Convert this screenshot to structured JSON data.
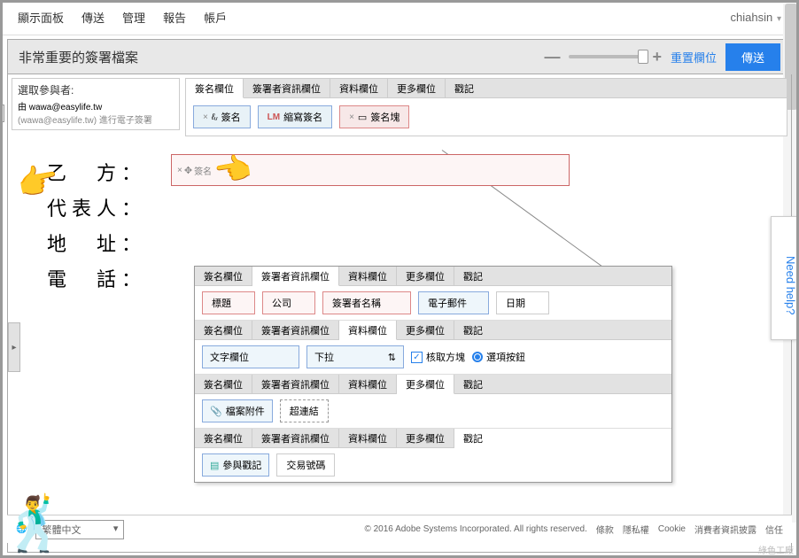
{
  "topnav": {
    "items": [
      "顯示面板",
      "傳送",
      "管理",
      "報告",
      "帳戶"
    ],
    "user": "chiahsin"
  },
  "doc": {
    "title": "非常重要的簽署檔案",
    "reset": "重置欄位",
    "send": "傳送"
  },
  "participant": {
    "label": "選取參與者:",
    "line1": "由 wawa@easylife.tw",
    "line2": "(wawa@easylife.tw) 進行電子簽署"
  },
  "tabs": [
    "簽名欄位",
    "簽署者資訊欄位",
    "資料欄位",
    "更多欄位",
    "戳記"
  ],
  "sig_fields": {
    "sign": "簽名",
    "sign_prefix": "×",
    "sign_icon": "ℓᵤ",
    "initials": "縮寫簽名",
    "initials_prefix": "LM",
    "block": "簽名塊",
    "block_prefix": "×"
  },
  "form": {
    "rows": [
      "乙　方：",
      "代表人：",
      "地　址：",
      "電　話："
    ],
    "field_hint": "簽名"
  },
  "info_fields": {
    "title": "標題",
    "company": "公司",
    "signer": "簽署者名稱",
    "email": "電子郵件",
    "date": "日期"
  },
  "data_fields": {
    "text": "文字欄位",
    "dropdown": "下拉",
    "checkbox": "核取方塊",
    "radio": "選項按鈕"
  },
  "more_fields": {
    "attach": "檔案附件",
    "link": "超連結"
  },
  "stamp_fields": {
    "participant": "參與戳記",
    "transaction": "交易號碼"
  },
  "footer": {
    "lang": "繁體中文",
    "copyright": "© 2016 Adobe Systems Incorporated. All rights reserved.",
    "links": [
      "條款",
      "隱私權",
      "Cookie",
      "消費者資訊披露",
      "信任"
    ]
  },
  "help": "Need help?",
  "watermark": "綠色工廠"
}
